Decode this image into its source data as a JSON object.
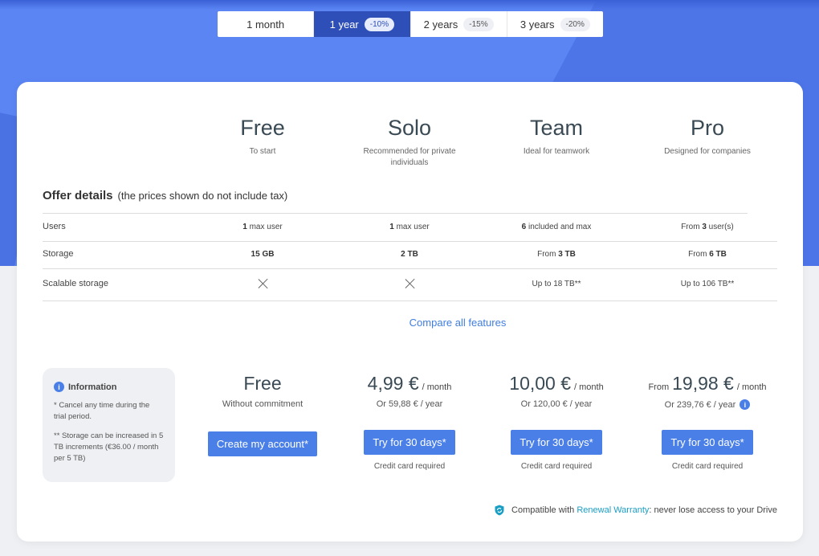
{
  "periods": [
    {
      "label": "1 month",
      "badge": ""
    },
    {
      "label": "1 year",
      "badge": "-10%"
    },
    {
      "label": "2 years",
      "badge": "-15%"
    },
    {
      "label": "3 years",
      "badge": "-20%"
    }
  ],
  "active_period": "1 year",
  "plans": [
    {
      "name": "Free",
      "desc": "To start"
    },
    {
      "name": "Solo",
      "desc": "Recommended for private individuals"
    },
    {
      "name": "Team",
      "desc": "Ideal for teamwork"
    },
    {
      "name": "Pro",
      "desc": "Designed for companies"
    }
  ],
  "offer": {
    "title": "Offer details",
    "note": "(the prices shown do not include tax)",
    "rows": {
      "users": {
        "label": "Users",
        "free": {
          "bold": "1",
          "rest": " max user"
        },
        "solo": {
          "bold": "1",
          "rest": " max user"
        },
        "team": {
          "bold": "6",
          "rest": " included and max"
        },
        "pro": {
          "pre": "From ",
          "bold": "3",
          "rest": " user(s)"
        }
      },
      "storage": {
        "label": "Storage",
        "free": {
          "bold": "15 GB"
        },
        "solo": {
          "bold": "2 TB"
        },
        "team": {
          "pre": "From ",
          "bold": "3 TB"
        },
        "pro": {
          "pre": "From ",
          "bold": "6 TB"
        }
      },
      "scalable": {
        "label": "Scalable storage",
        "team": "Up to 18 TB**",
        "pro": "Up to 106 TB**"
      }
    }
  },
  "compare_link": "Compare all features",
  "information": {
    "title": "Information",
    "note1": "* Cancel any time during the trial period.",
    "note2": "** Storage can be increased in 5 TB increments (€36.00 / month per 5 TB)"
  },
  "pricing": {
    "free": {
      "amount": "Free",
      "sub": "Without commitment",
      "button": "Create my account*"
    },
    "solo": {
      "amount": "4,99 €",
      "per": "/ month",
      "sub": "Or 59,88 € / year",
      "button": "Try for 30 days*",
      "note": "Credit card required"
    },
    "team": {
      "amount": "10,00 €",
      "per": "/ month",
      "sub": "Or 120,00 € / year",
      "button": "Try for 30 days*",
      "note": "Credit card required"
    },
    "pro": {
      "from": "From",
      "amount": "19,98 €",
      "per": "/ month",
      "sub": "Or 239,76 € / year",
      "button": "Try for 30 days*",
      "note": "Credit card required"
    }
  },
  "footer": {
    "pre": "Compatible with ",
    "link": "Renewal Warranty",
    "post": ": never lose access to your Drive"
  },
  "colors": {
    "brand": "#5a85f3",
    "button": "#4a7fe8",
    "active_tab": "#2e4fb8",
    "link": "#1a9ec4"
  }
}
